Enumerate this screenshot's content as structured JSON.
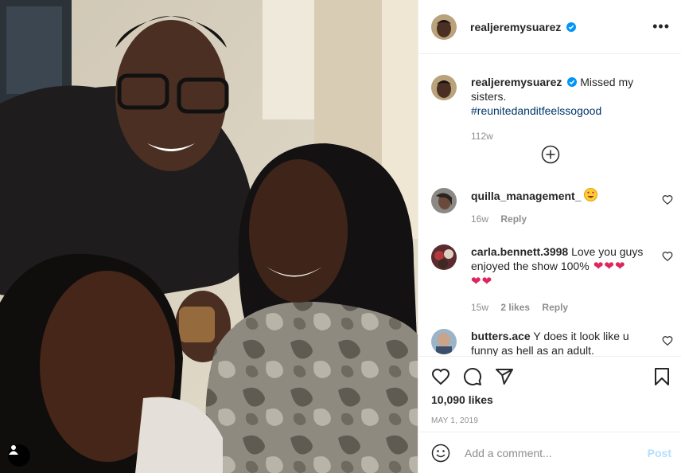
{
  "post": {
    "username": "realjeremysuarez",
    "verified": true,
    "more_icon": "more-horizontal-icon",
    "caption": {
      "text": "Missed my sisters.",
      "hashtag": "#reunitedanditfeelssogood",
      "time": "112w"
    },
    "load_more_icon": "plus-circle-icon",
    "comments": [
      {
        "user": "quilla_management_",
        "text": "",
        "emoji": "heart-eyes-emoji",
        "time": "16w",
        "likes": "",
        "reply": "Reply"
      },
      {
        "user": "carla.bennett.3998",
        "text_line1": "Love you guys",
        "text_line2": "enjoyed the show 100%",
        "hearts": 5,
        "time": "15w",
        "likes": "2 likes",
        "reply": "Reply"
      },
      {
        "user": "butters.ace",
        "text_line1": "Y does it look like u",
        "text_line2": "funny as hell as an adult."
      }
    ],
    "likes": "10,090 likes",
    "date": "MAY 1, 2019",
    "add_comment_placeholder": "Add a comment...",
    "post_button": "Post",
    "colors": {
      "accent_blue": "#0095f6",
      "hashtag": "#00376b",
      "heart_red": "#ed4956",
      "post_disabled": "#b2dffc"
    }
  }
}
